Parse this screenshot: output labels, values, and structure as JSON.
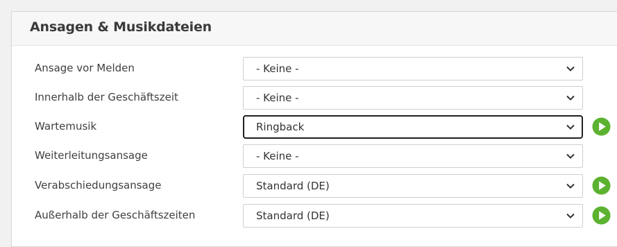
{
  "section": {
    "title": "Ansagen & Musikdateien"
  },
  "rows": [
    {
      "label": "Ansage vor Melden",
      "value": "- Keine -",
      "has_play": false,
      "focused": false
    },
    {
      "label": "Innerhalb der Geschäftszeit",
      "value": "- Keine -",
      "has_play": false,
      "focused": false
    },
    {
      "label": "Wartemusik",
      "value": "Ringback",
      "has_play": true,
      "focused": true
    },
    {
      "label": "Weiterleitungsansage",
      "value": "- Keine -",
      "has_play": false,
      "focused": false
    },
    {
      "label": "Verabschiedungsansage",
      "value": "Standard (DE)",
      "has_play": true,
      "focused": false
    },
    {
      "label": "Außerhalb der Geschäftszeiten",
      "value": "Standard (DE)",
      "has_play": true,
      "focused": false
    }
  ],
  "icons": {
    "dropdown": "chevron-down-icon",
    "play": "play-icon"
  },
  "colors": {
    "play_green": "#5cb230",
    "focus_border": "#202020"
  }
}
